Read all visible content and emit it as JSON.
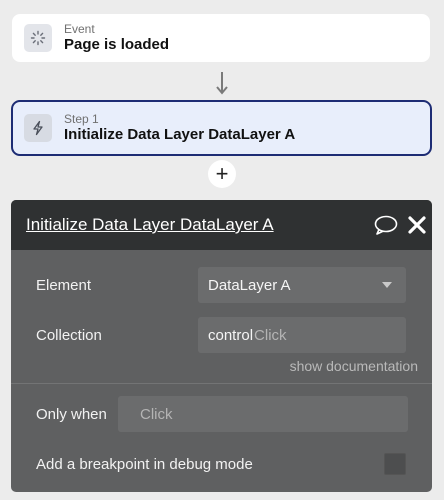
{
  "event_card": {
    "subtitle": "Event",
    "title": "Page is loaded",
    "icon": "loading-spinner-icon"
  },
  "step_card": {
    "subtitle": "Step 1",
    "title": "Initialize Data Layer DataLayer A",
    "icon": "lightning-icon",
    "border_color": "#1d2c74"
  },
  "add_step": {
    "label": "+"
  },
  "panel": {
    "title": "Initialize Data Layer DataLayer A",
    "element_label": "Element",
    "element_value": "DataLayer A",
    "collection_label": "Collection",
    "collection_value": "control",
    "collection_placeholder": "Click",
    "doc_link": "show documentation",
    "only_when_label": "Only when",
    "only_when_placeholder": "Click",
    "breakpoint_label": "Add a breakpoint in debug mode",
    "breakpoint_checked": false
  }
}
